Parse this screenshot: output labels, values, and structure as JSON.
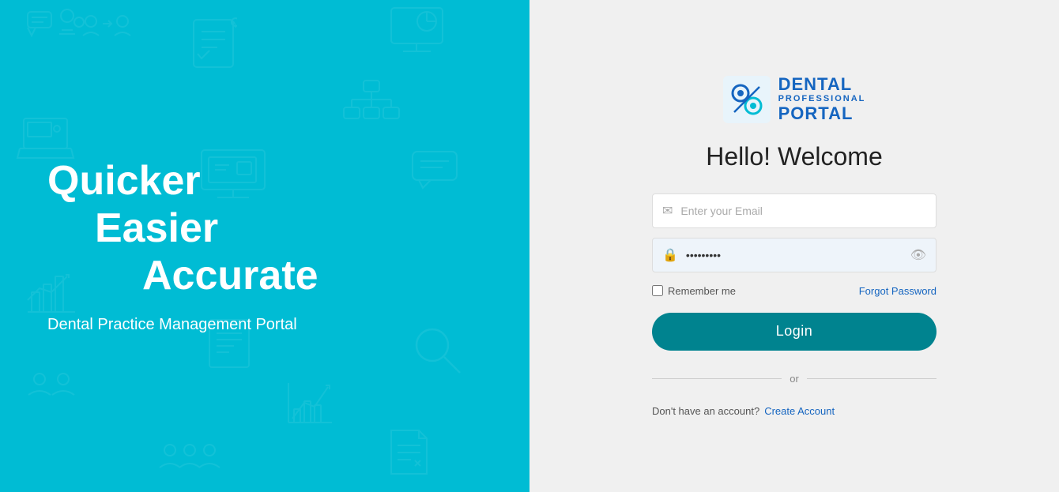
{
  "left": {
    "tagline": {
      "line1": "Quicker",
      "line2": "Easier",
      "line3": "Accurate"
    },
    "subtitle": "Dental Practice Management Portal"
  },
  "right": {
    "logo": {
      "dental": "DENTAL",
      "professional": "PROFESSIONAL",
      "portal": "PORTAL"
    },
    "welcome": "Hello! Welcome",
    "email_placeholder": "Enter your Email",
    "password_value": "·········",
    "remember_label": "Remember me",
    "forgot_label": "Forgot Password",
    "login_label": "Login",
    "or_label": "or",
    "no_account_label": "Don't have an account?",
    "create_account_label": "Create Account"
  },
  "colors": {
    "cyan": "#00BCD4",
    "teal": "#00838F",
    "blue": "#1565C0"
  }
}
